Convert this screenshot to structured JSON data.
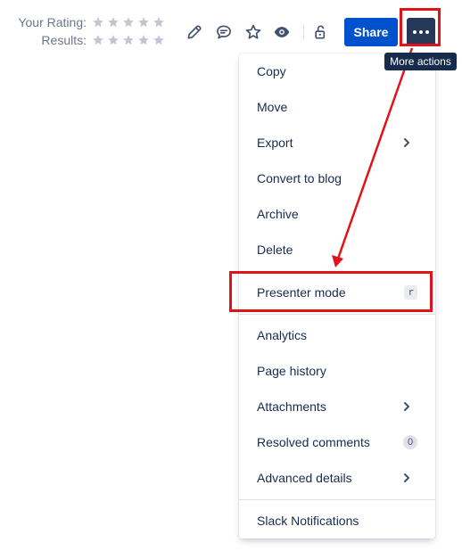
{
  "rating": {
    "your_rating_label": "Your Rating:",
    "results_label": "Results:",
    "max_stars": 5,
    "your_rating_value": 0,
    "results_value": 0
  },
  "toolbar": {
    "icons": [
      "pencil-icon",
      "comment-icon",
      "star-icon",
      "eye-icon",
      "unlock-icon"
    ],
    "share_label": "Share",
    "more_actions_tooltip": "More actions"
  },
  "menu": {
    "items": [
      {
        "label": "Copy"
      },
      {
        "label": "Move"
      },
      {
        "label": "Export",
        "submenu": true
      },
      {
        "label": "Convert to blog"
      },
      {
        "label": "Archive"
      },
      {
        "label": "Delete"
      },
      {
        "label": "Presenter mode",
        "shortcut": "r"
      },
      {
        "label": "Analytics"
      },
      {
        "label": "Page history"
      },
      {
        "label": "Attachments",
        "submenu": true
      },
      {
        "label": "Resolved comments",
        "badge": "0"
      },
      {
        "label": "Advanced details",
        "submenu": true
      },
      {
        "label": "Slack Notifications"
      }
    ]
  },
  "colors": {
    "share_button": "#0052cc",
    "more_button": "#253858",
    "annotation_red": "#e0131a",
    "star_empty": "#c1c7d0"
  }
}
